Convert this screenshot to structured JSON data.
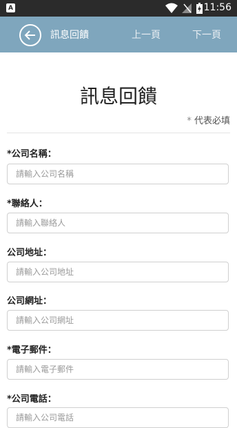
{
  "status_bar": {
    "time": "11:56",
    "app_icon_letter": "A"
  },
  "app_bar": {
    "title": "訊息回饋",
    "prev_label": "上一頁",
    "next_label": "下一頁",
    "color": "#7fa6bd"
  },
  "form": {
    "heading": "訊息回饋",
    "required_mark": "*",
    "required_note": "代表必填",
    "fields": [
      {
        "label": "*公司名稱：",
        "placeholder": "請輸入公司名稱",
        "value": ""
      },
      {
        "label": "*聯絡人：",
        "placeholder": "請輸入聯絡人",
        "value": ""
      },
      {
        "label": "公司地址：",
        "placeholder": "請輸入公司地址",
        "value": ""
      },
      {
        "label": "公司網址：",
        "placeholder": "請輸入公司網址",
        "value": ""
      },
      {
        "label": "*電子郵件：",
        "placeholder": "請輸入電子郵件",
        "value": ""
      },
      {
        "label": "*公司電話：",
        "placeholder": "請輸入公司電話",
        "value": ""
      }
    ]
  },
  "icons": {
    "back": "back-arrow-icon",
    "wifi": "wifi-icon",
    "signal": "cellular-signal-icon",
    "battery": "battery-charging-icon"
  }
}
